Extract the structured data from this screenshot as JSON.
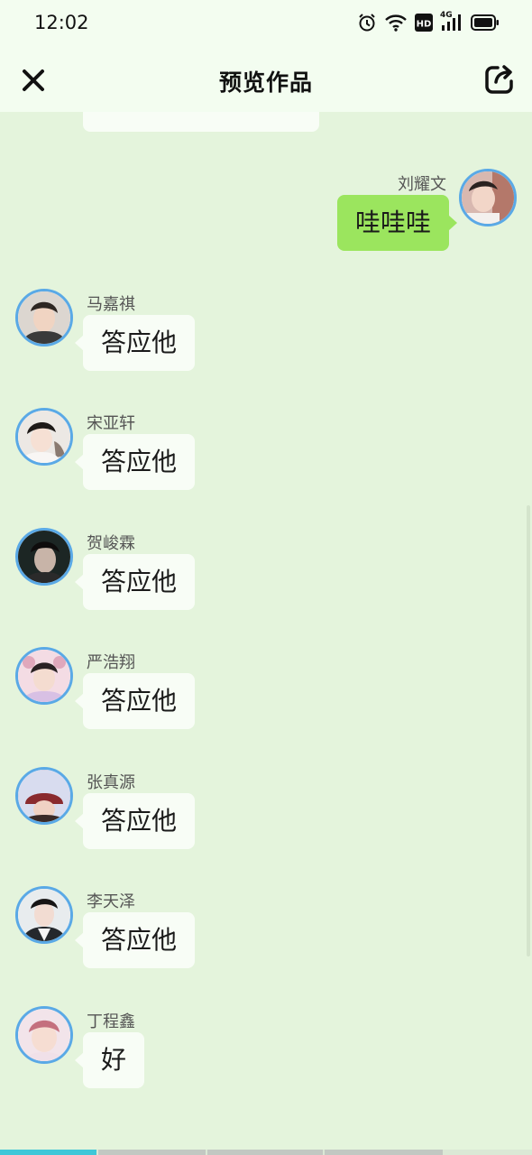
{
  "status_bar": {
    "time": "12:02",
    "icons": [
      "alarm-icon",
      "wifi-icon",
      "hd-icon",
      "signal-4g-icon",
      "battery-icon"
    ],
    "hd_label": "HD",
    "network_label": "4G"
  },
  "navbar": {
    "title": "预览作品",
    "close_icon": "close-icon",
    "share_icon": "share-icon"
  },
  "messages": [
    {
      "sender": "刘耀文",
      "text": "哇哇哇",
      "side": "right"
    },
    {
      "sender": "马嘉祺",
      "text": "答应他",
      "side": "left"
    },
    {
      "sender": "宋亚轩",
      "text": "答应他",
      "side": "left"
    },
    {
      "sender": "贺峻霖",
      "text": "答应他",
      "side": "left"
    },
    {
      "sender": "严浩翔",
      "text": "答应他",
      "side": "left"
    },
    {
      "sender": "张真源",
      "text": "答应他",
      "side": "left"
    },
    {
      "sender": "李天泽",
      "text": "答应他",
      "side": "left"
    },
    {
      "sender": "丁程鑫",
      "text": "好",
      "side": "left"
    }
  ],
  "colors": {
    "background": "#e4f4dc",
    "header": "#f3fdf0",
    "bubble_left": "#f8fdf6",
    "bubble_right": "#9be55e",
    "avatar_ring": "#5aa9e6",
    "progress_accent": "#3ec7d8"
  }
}
